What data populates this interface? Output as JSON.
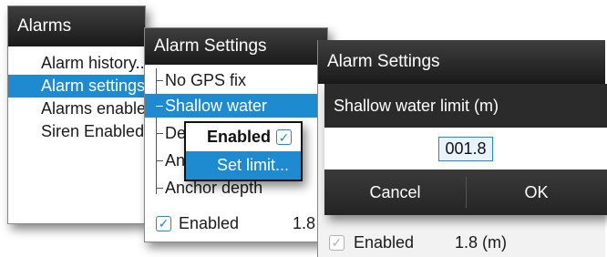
{
  "alarms_menu": {
    "title": "Alarms",
    "items": [
      {
        "label": "Alarm history..."
      },
      {
        "label": "Alarm settings..."
      },
      {
        "label": "Alarms enabled"
      },
      {
        "label": "Siren Enabled"
      }
    ]
  },
  "alarm_settings_menu": {
    "title": "Alarm Settings",
    "items": [
      {
        "label": "No GPS fix"
      },
      {
        "label": "Shallow water"
      },
      {
        "label": "Deep water"
      },
      {
        "label": "Anchor"
      },
      {
        "label": "Anchor depth"
      }
    ],
    "enabled_label": "Enabled",
    "enabled_value": "1.8"
  },
  "submenu": {
    "enabled_label": "Enabled",
    "set_limit_label": "Set limit..."
  },
  "alarm_settings_back": {
    "title": "Alarm Settings",
    "enabled_label": "Enabled",
    "enabled_value": "1.8 (m)"
  },
  "limit_dialog": {
    "title": "Shallow water limit (m)",
    "value": "001.8",
    "cancel_label": "Cancel",
    "ok_label": "OK"
  },
  "colors": {
    "accent": "#1e8ad0",
    "titlebar": "#2a2a2a",
    "separator": "#d02020"
  }
}
